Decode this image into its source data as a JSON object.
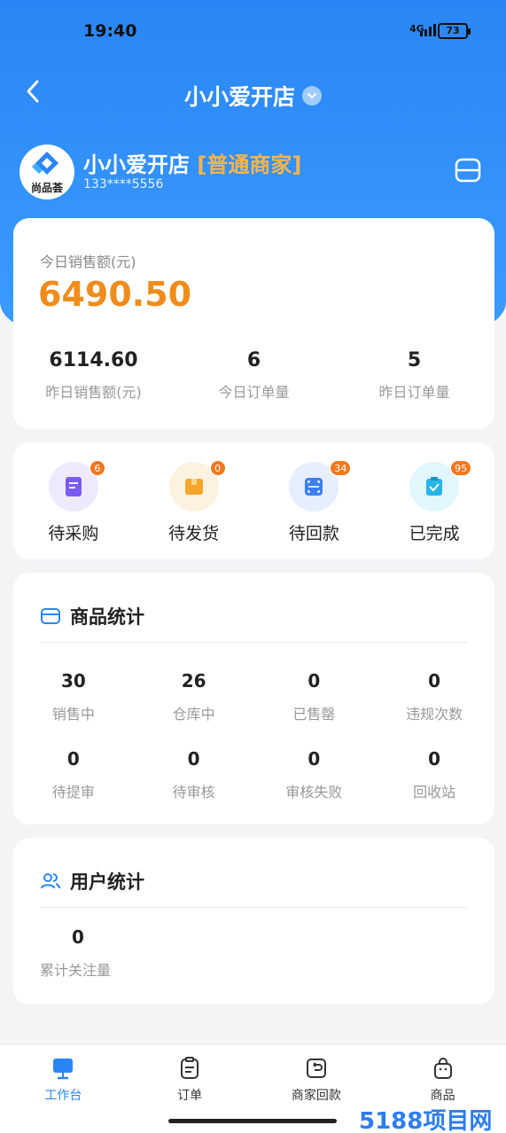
{
  "status_bar": {
    "time": "19:40",
    "network": "4G",
    "battery": "73"
  },
  "nav": {
    "title": "小小爱开店"
  },
  "store": {
    "logo_text": "尚品荟",
    "name": "小小爱开店",
    "tag": "[普通商家]",
    "phone": "133****5556"
  },
  "sales": {
    "today_label": "今日销售额(元)",
    "today_value": "6490.50",
    "stats": [
      {
        "value": "6114.60",
        "label": "昨日销售额(元)"
      },
      {
        "value": "6",
        "label": "今日订单量"
      },
      {
        "value": "5",
        "label": "昨日订单量"
      }
    ]
  },
  "orders": [
    {
      "label": "待采购",
      "badge": "6",
      "icon": "purchase-icon",
      "color": "#7c5cf0",
      "bg": "#eee9fd"
    },
    {
      "label": "待发货",
      "badge": "0",
      "icon": "box-icon",
      "color": "#f7a52a",
      "bg": "#fdf1e0"
    },
    {
      "label": "待回款",
      "badge": "34",
      "icon": "scan-icon",
      "color": "#3d7ef5",
      "bg": "#e6efff"
    },
    {
      "label": "已完成",
      "badge": "95",
      "icon": "clipboard-check-icon",
      "color": "#27b5e8",
      "bg": "#e2f6fd"
    }
  ],
  "goods": {
    "title": "商品统计",
    "row1": [
      {
        "value": "30",
        "label": "销售中"
      },
      {
        "value": "26",
        "label": "仓库中"
      },
      {
        "value": "0",
        "label": "已售罄"
      },
      {
        "value": "0",
        "label": "违规次数"
      }
    ],
    "row2": [
      {
        "value": "0",
        "label": "待提审"
      },
      {
        "value": "0",
        "label": "待审核"
      },
      {
        "value": "0",
        "label": "审核失败"
      },
      {
        "value": "0",
        "label": "回收站"
      }
    ]
  },
  "users": {
    "title": "用户统计",
    "value": "0",
    "label": "累计关注量"
  },
  "tabs": [
    {
      "label": "工作台",
      "icon": "monitor-icon",
      "active": true
    },
    {
      "label": "订单",
      "icon": "order-icon",
      "active": false
    },
    {
      "label": "商家回款",
      "icon": "refund-icon",
      "active": false
    },
    {
      "label": "商品",
      "icon": "bag-icon",
      "active": false
    }
  ],
  "watermark": "5188项目网",
  "colors": {
    "primary": "#2a86f6",
    "accent": "#f08c1c",
    "tag": "#ffb44a"
  }
}
